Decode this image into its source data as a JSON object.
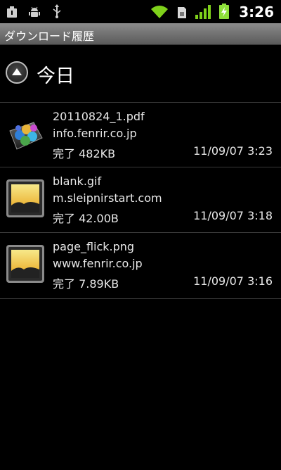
{
  "status_bar": {
    "time": "3:26",
    "left_icons": [
      "usb-storage-icon",
      "android-debug-icon",
      "usb-icon"
    ],
    "right_icons": [
      "wifi-icon",
      "sim-icon",
      "signal-icon",
      "battery-charging-icon"
    ]
  },
  "title_bar": {
    "title": "ダウンロード履歴"
  },
  "section": {
    "label": "今日",
    "icon": "collapse-up-icon"
  },
  "downloads": [
    {
      "name": "20110824_1.pdf",
      "source": "info.fenrir.co.jp",
      "status": "完了 482KB",
      "time": "11/09/07 3:23",
      "icon": "pdf-file-icon"
    },
    {
      "name": "blank.gif",
      "source": "m.sleipnirstart.com",
      "status": "完了 42.00B",
      "time": "11/09/07 3:18",
      "icon": "image-file-icon"
    },
    {
      "name": "page_flick.png",
      "source": "www.fenrir.co.jp",
      "status": "完了 7.89KB",
      "time": "11/09/07 3:16",
      "icon": "image-file-icon"
    }
  ],
  "colors": {
    "background": "#000000",
    "title_bar": "#6f6f6f",
    "wifi": "#7fd11b",
    "battery": "#8ee03a"
  }
}
